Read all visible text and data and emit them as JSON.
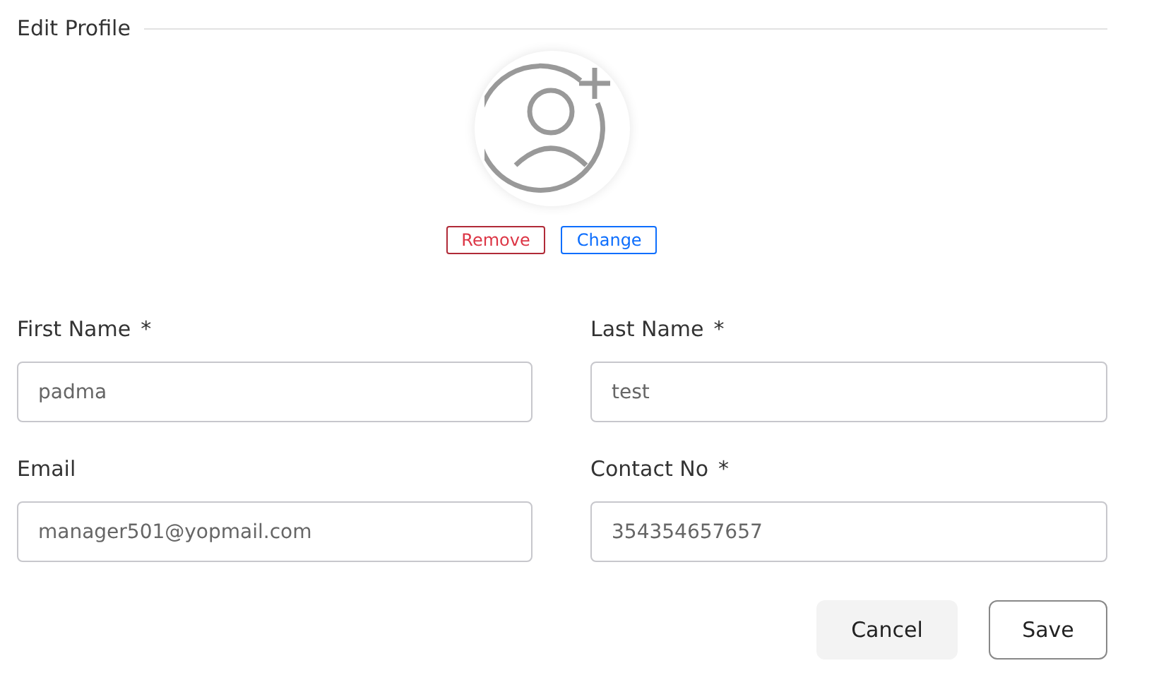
{
  "title": "Edit Profile",
  "photo_actions": [
    {
      "kind": "danger",
      "label": "Remove"
    },
    {
      "kind": "primary",
      "label": "Change"
    }
  ],
  "fields": [
    {
      "label": "First Name",
      "required_mark": "*",
      "value": "padma"
    },
    {
      "label": "Last Name",
      "required_mark": "*",
      "value": "test"
    },
    {
      "label": "Email",
      "value": "manager501@yopmail.com"
    },
    {
      "label": "Contact No",
      "required_mark": "*",
      "value": "354354657657"
    }
  ],
  "buttons": [
    {
      "kind": "secondary",
      "label": "Cancel"
    },
    {
      "kind": "outline",
      "label": "Save"
    }
  ]
}
